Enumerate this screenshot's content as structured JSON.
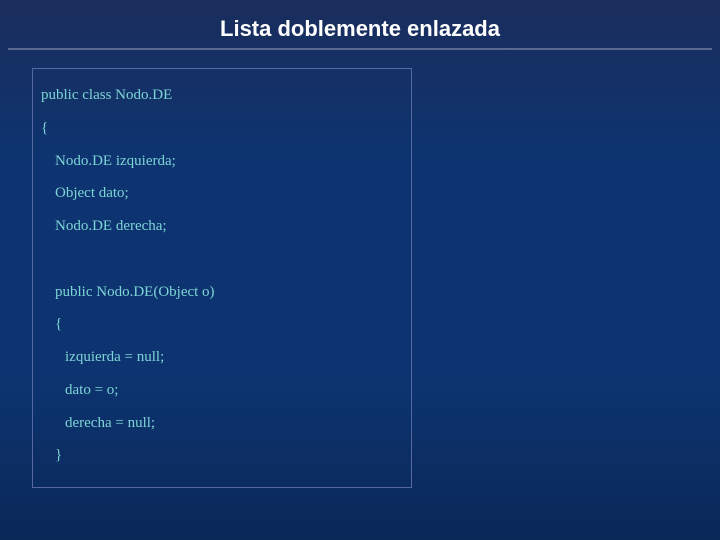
{
  "title": "Lista doblemente enlazada",
  "code": {
    "l0": "public class Nodo.DE",
    "l1": "{",
    "l2": "Nodo.DE izquierda;",
    "l3": "Object dato;",
    "l4": "Nodo.DE derecha;",
    "l5": "public Nodo.DE(Object o)",
    "l6": "{",
    "l7": "izquierda = null;",
    "l8": "dato = o;",
    "l9": "derecha = null;",
    "l10": "}"
  }
}
